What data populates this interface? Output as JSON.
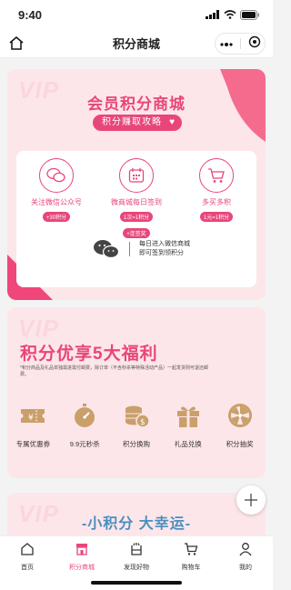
{
  "status": {
    "time": "9:40"
  },
  "nav": {
    "title": "积分商城"
  },
  "card1": {
    "vip": "VIP",
    "title": "会员积分商城",
    "strategy": "积分赚取攻略",
    "tasks": [
      {
        "label": "关注微信公众号",
        "badge": "+30积分",
        "badge2": ""
      },
      {
        "label": "微商城每日签到",
        "badge": "1次=1积分",
        "badge2": "+连签奖"
      },
      {
        "label": "多买多积",
        "badge": "1元=1积分",
        "badge2": ""
      }
    ],
    "wx_line1": "每日进入微信商城",
    "wx_line2": "即可签到领积分"
  },
  "card2": {
    "vip": "VIP",
    "title": "积分优享5大福利",
    "note": "*积分商品及礼品单独需进需付邮费，除订单（不含秒杀等特殊活动产品）一起发货则可退还邮费。",
    "benefits": [
      {
        "label": "专属优惠券",
        "icon": "coupon-icon"
      },
      {
        "label": "9.9元秒杀",
        "icon": "stopwatch-icon"
      },
      {
        "label": "积分换购",
        "icon": "coins-icon"
      },
      {
        "label": "礼品兑换",
        "icon": "gift-icon"
      },
      {
        "label": "积分抽奖",
        "icon": "wheel-icon"
      }
    ]
  },
  "card3": {
    "vip": "VIP",
    "title": "-小积分 大幸运-"
  },
  "tabs": [
    {
      "label": "首页",
      "icon": "home-icon"
    },
    {
      "label": "积分商城",
      "icon": "shop-icon"
    },
    {
      "label": "发现好物",
      "icon": "discover-icon"
    },
    {
      "label": "购物车",
      "icon": "cart-icon"
    },
    {
      "label": "我的",
      "icon": "user-icon"
    }
  ],
  "colors": {
    "accent": "#e8467a",
    "card_bg": "#fde6ea",
    "gold": "#c9a06a",
    "blue_title": "#4a8fbe"
  }
}
